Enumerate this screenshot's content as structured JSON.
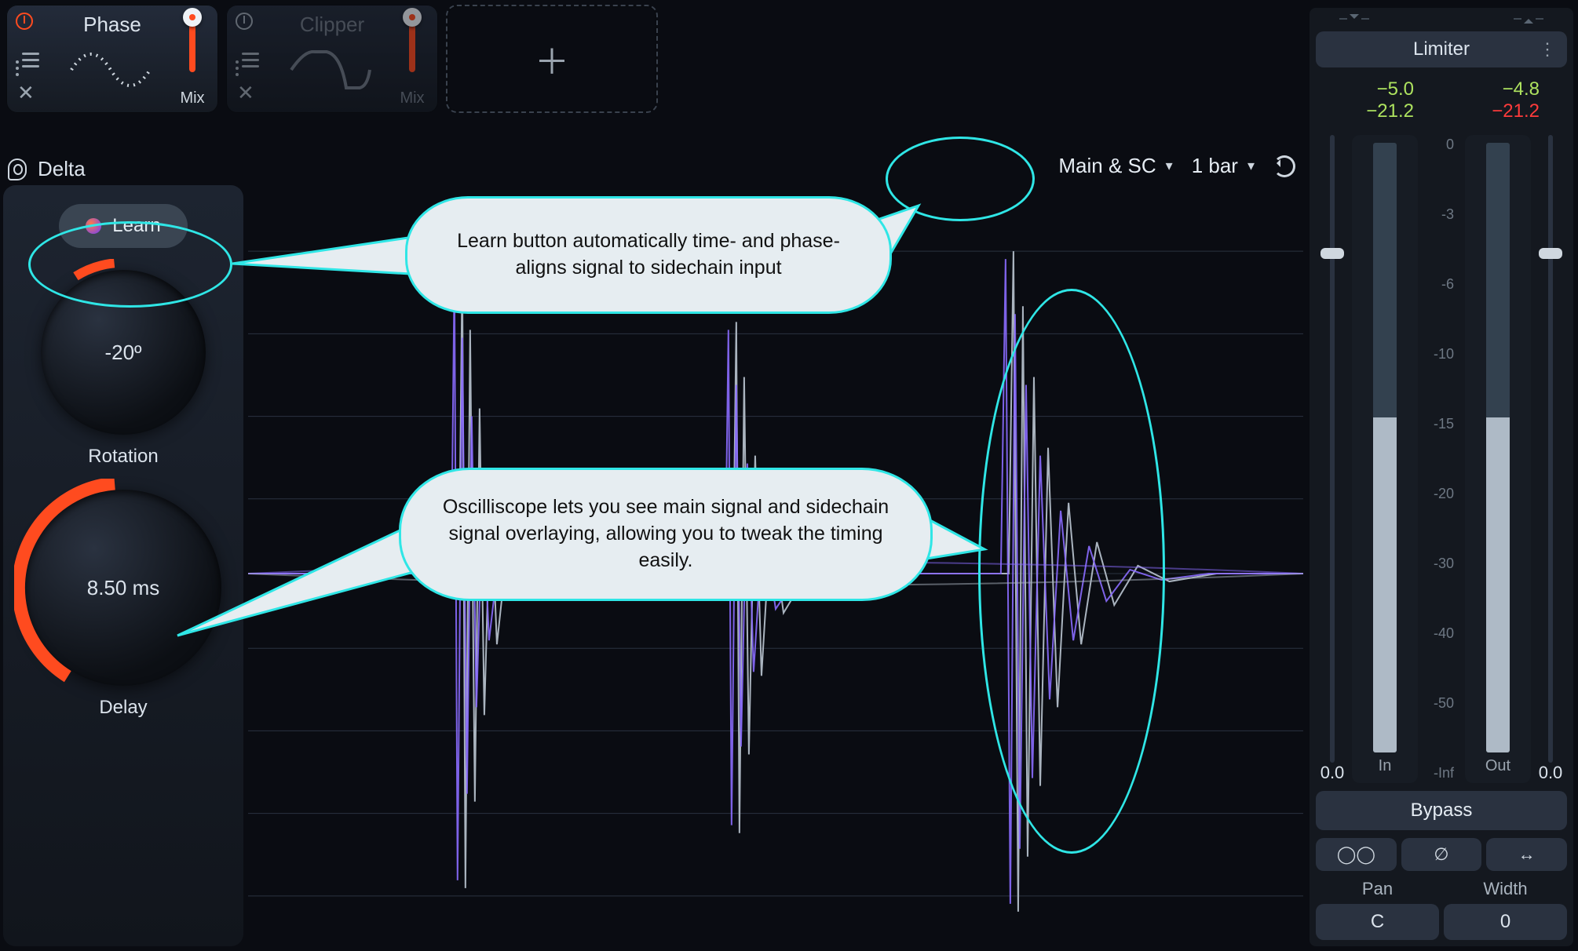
{
  "modules": {
    "phase": {
      "title": "Phase",
      "mix_label": "Mix"
    },
    "clipper": {
      "title": "Clipper",
      "mix_label": "Mix"
    }
  },
  "delta_label": "Delta",
  "scope": {
    "source": "Main & SC",
    "window": "1 bar"
  },
  "sidebar": {
    "learn_label": "Learn",
    "rotation_value": "-20º",
    "rotation_label": "Rotation",
    "delay_value": "8.50 ms",
    "delay_label": "Delay"
  },
  "limiter": {
    "title": "Limiter",
    "in_peak": "−5.0",
    "in_hold": "−21.2",
    "out_peak": "−4.8",
    "out_hold": "−21.2",
    "scale": [
      "0",
      "-3",
      "-6",
      "-10",
      "-15",
      "-20",
      "-30",
      "-40",
      "-50",
      "-Inf"
    ],
    "in_label": "In",
    "out_label": "Out",
    "in_val": "0.0",
    "out_val": "0.0",
    "bypass": "Bypass",
    "pan_label": "Pan",
    "pan_val": "C",
    "width_label": "Width",
    "width_val": "0"
  },
  "callouts": {
    "learn": "Learn button automatically time- and phase-aligns signal to sidechain input",
    "scope": "Oscilliscope lets you see main signal and sidechain signal overlaying, allowing you to tweak the timing easily."
  }
}
